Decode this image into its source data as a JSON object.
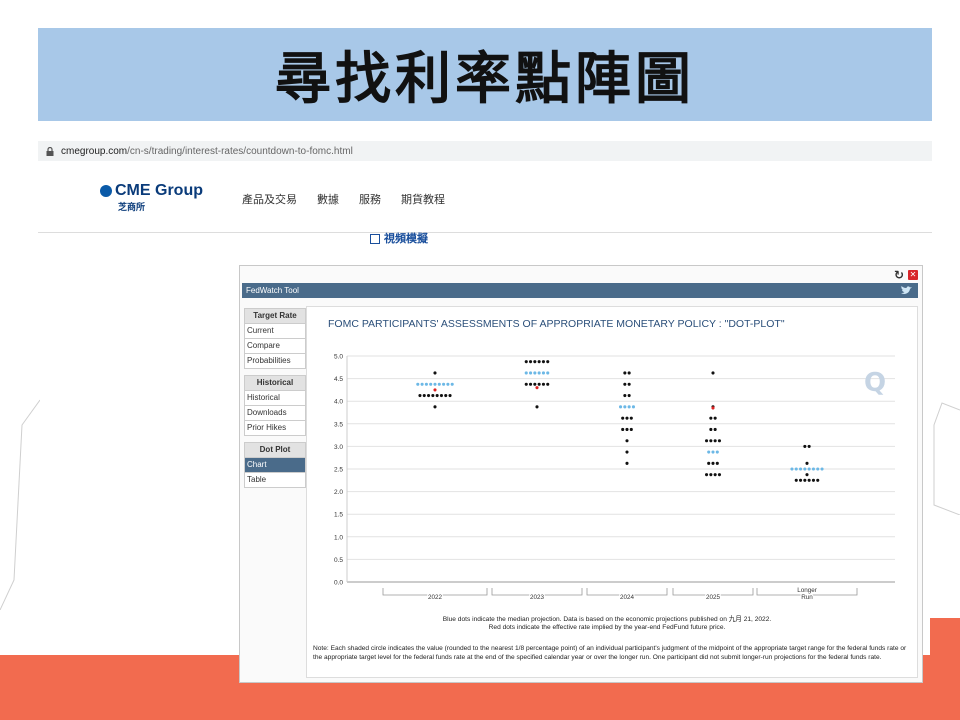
{
  "slide": {
    "title": "尋找利率點陣圖",
    "colors": {
      "banner": "#a8c8e8",
      "accent_band": "#f26b4f"
    }
  },
  "browser": {
    "url_host": "cmegroup.com",
    "url_path": "/cn-s/trading/interest-rates/countdown-to-fomc.html",
    "lock_icon": "lock-icon"
  },
  "site": {
    "logo_text": "CME Group",
    "logo_subtext": "芝商所",
    "nav": [
      "產品及交易",
      "數據",
      "服務",
      "期貨教程"
    ],
    "video_link": "視頻模擬"
  },
  "fedwatch": {
    "tool_name": "FedWatch Tool",
    "sidebar": [
      {
        "heading": "Target Rate",
        "items": [
          "Current",
          "Compare",
          "Probabilities"
        ]
      },
      {
        "heading": "Historical",
        "items": [
          "Historical",
          "Downloads",
          "Prior Hikes"
        ]
      },
      {
        "heading": "Dot Plot",
        "items": [
          "Chart",
          "Table"
        ]
      }
    ],
    "active_item": "Chart",
    "watermark": "Q",
    "note": "Note: Each shaded circle indicates the value (rounded to the nearest 1/8 percentage point) of an individual participant's judgment of the midpoint of the appropriate target range for the federal funds rate or the appropriate target level for the federal funds rate at the end of the specified calendar year or over the longer run. One participant did not submit longer-run projections for the federal funds rate.",
    "colors": {
      "bar": "#4a6b8a",
      "dot": "#111111",
      "median": "#6cb8e6",
      "implied": "#e02424"
    }
  },
  "chart_data": {
    "type": "scatter",
    "title": "FOMC PARTICIPANTS' ASSESSMENTS OF APPROPRIATE MONETARY POLICY : \"DOT-PLOT\"",
    "categories": [
      "2022",
      "2023",
      "2024",
      "2025",
      "Longer Run"
    ],
    "ylim": [
      0,
      5
    ],
    "yticks": [
      "0.0",
      "0.5",
      "1.0",
      "1.5",
      "2.0",
      "2.5",
      "3.0",
      "3.5",
      "4.0",
      "4.5",
      "5.0"
    ],
    "grid": true,
    "dots": [
      {
        "category": "2022",
        "counts": {
          "4.625": 1,
          "4.375": 9,
          "4.125": 8,
          "3.875": 1
        }
      },
      {
        "category": "2023",
        "counts": {
          "4.875": 6,
          "4.625": 6,
          "4.375": 6,
          "3.875": 1
        }
      },
      {
        "category": "2024",
        "counts": {
          "4.625": 2,
          "4.375": 2,
          "4.125": 2,
          "3.875": 4,
          "3.625": 3,
          "3.375": 3,
          "3.125": 1,
          "2.875": 1,
          "2.625": 1
        }
      },
      {
        "category": "2025",
        "counts": {
          "4.625": 1,
          "3.875": 1,
          "3.625": 2,
          "3.375": 2,
          "3.125": 4,
          "2.875": 3,
          "2.625": 3,
          "2.375": 4
        }
      },
      {
        "category": "Longer Run",
        "counts": {
          "3.0": 2,
          "2.625": 1,
          "2.5": 8,
          "2.375": 1,
          "2.25": 6
        }
      }
    ],
    "medians": [
      {
        "category": "2022",
        "value": 4.375,
        "count": 9
      },
      {
        "category": "2023",
        "value": 4.625,
        "count": 6
      },
      {
        "category": "2024",
        "value": 3.875,
        "count": 4
      },
      {
        "category": "2025",
        "value": 2.875,
        "count": 3
      },
      {
        "category": "Longer Run",
        "value": 2.5,
        "count": 8
      }
    ],
    "implied": [
      {
        "category": "2022",
        "value": 4.25
      },
      {
        "category": "2023",
        "value": 4.3
      },
      {
        "category": "2025",
        "value": 3.85
      }
    ],
    "caption_line1": "Blue dots indicate the median projection. Data is based on the economic projections published on 九月 21, 2022.",
    "caption_line2": "Red dots indicate the effective rate implied by the year-end FedFund future price."
  }
}
